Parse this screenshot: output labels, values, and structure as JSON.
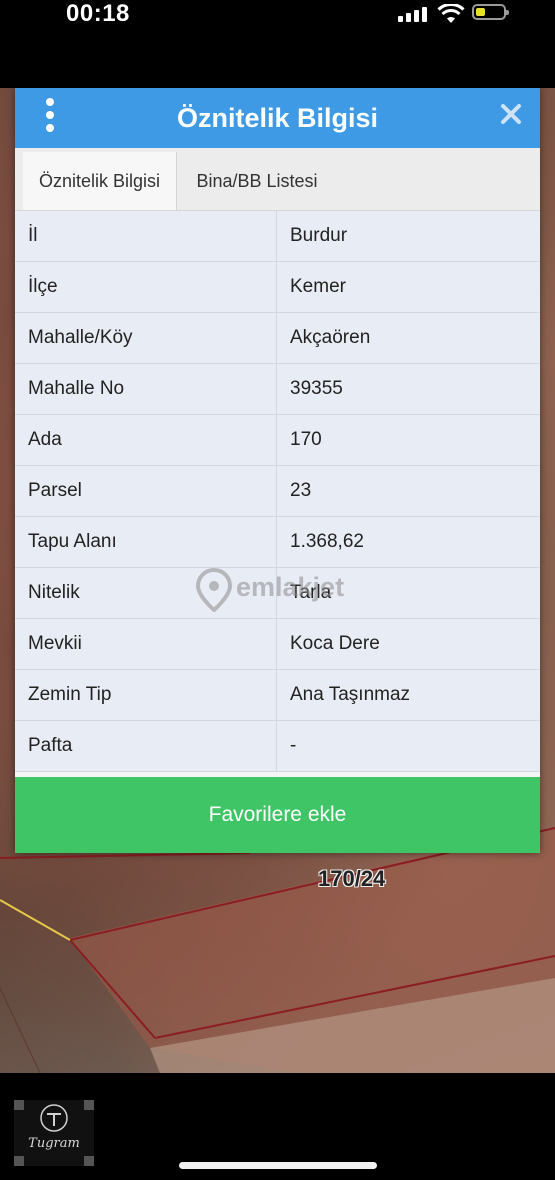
{
  "status_bar": {
    "time": "00:18"
  },
  "dialog": {
    "title": "Öznitelik Bilgisi",
    "tabs": [
      {
        "label": "Öznitelik Bilgisi",
        "active": true
      },
      {
        "label": "Bina/BB Listesi",
        "active": false
      }
    ],
    "rows": [
      {
        "key": "İl",
        "value": "Burdur"
      },
      {
        "key": "İlçe",
        "value": "Kemer"
      },
      {
        "key": "Mahalle/Köy",
        "value": "Akçaören"
      },
      {
        "key": "Mahalle No",
        "value": "39355"
      },
      {
        "key": "Ada",
        "value": "170"
      },
      {
        "key": "Parsel",
        "value": "23"
      },
      {
        "key": "Tapu Alanı",
        "value": "1.368,62"
      },
      {
        "key": "Nitelik",
        "value": "Tarla"
      },
      {
        "key": "Mevkii",
        "value": "Koca Dere"
      },
      {
        "key": "Zemin Tip",
        "value": "Ana Taşınmaz"
      },
      {
        "key": "Pafta",
        "value": "-"
      }
    ],
    "favorite_button": "Favorilere ekle"
  },
  "watermark": "emlakjet",
  "map": {
    "parcel_label": "170/24"
  },
  "logo": {
    "text": "Tugram"
  },
  "colors": {
    "header": "#3f9ae6",
    "button": "#3fc566"
  }
}
